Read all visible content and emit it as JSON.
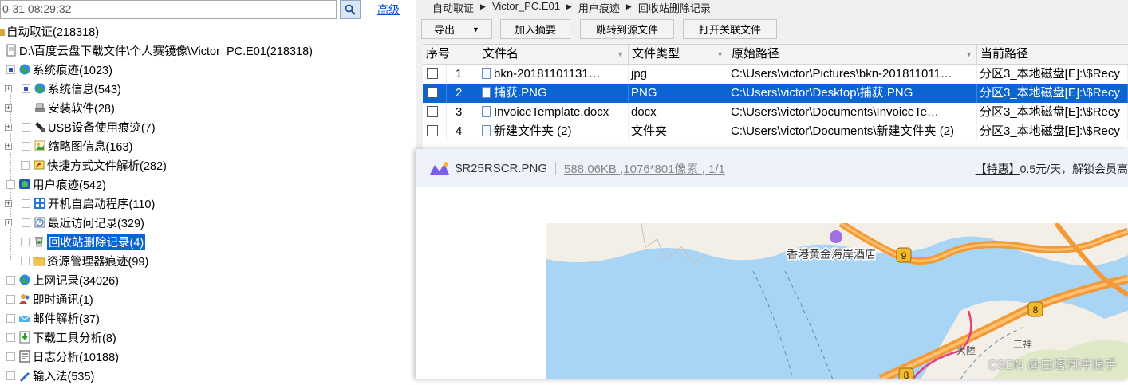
{
  "search": {
    "value": "0-31 08:29:32",
    "advanced_label": "高级"
  },
  "tree": [
    {
      "label": "自动取证(218318)",
      "checked": false
    },
    {
      "label": "D:\\百度云盘下载文件\\个人赛镜像\\Victor_PC.E01(218318)"
    },
    {
      "label": "系统痕迹(1023)"
    },
    {
      "label": "系统信息(543)"
    },
    {
      "label": "安装软件(28)"
    },
    {
      "label": "USB设备使用痕迹(7)"
    },
    {
      "label": "缩略图信息(163)"
    },
    {
      "label": "快捷方式文件解析(282)"
    },
    {
      "label": "用户痕迹(542)"
    },
    {
      "label": "开机自启动程序(110)"
    },
    {
      "label": "最近访问记录(329)"
    },
    {
      "label": "回收站删除记录(4)"
    },
    {
      "label": "资源管理器痕迹(99)"
    },
    {
      "label": "上网记录(34026)"
    },
    {
      "label": "即时通讯(1)"
    },
    {
      "label": "邮件解析(37)"
    },
    {
      "label": "下载工具分析(8)"
    },
    {
      "label": "日志分析(10188)"
    },
    {
      "label": "输入法(535)"
    }
  ],
  "breadcrumb": [
    "自动取证",
    "Victor_PC.E01",
    "用户痕迹",
    "回收站删除记录"
  ],
  "toolbar": {
    "export": "导出",
    "add_summary": "加入摘要",
    "jump_source": "跳转到源文件",
    "open_related": "打开关联文件"
  },
  "table": {
    "headers": [
      "序号",
      "文件名",
      "文件类型",
      "原始路径",
      "当前路径"
    ],
    "rows": [
      {
        "no": "1",
        "name": "bkn-20181101131…",
        "type": "jpg",
        "orig": "C:\\Users\\victor\\Pictures\\bkn-201811011…",
        "cur": "分区3_本地磁盘[E]:\\$Recy"
      },
      {
        "no": "2",
        "name": "捕获.PNG",
        "type": "PNG",
        "orig": "C:\\Users\\victor\\Desktop\\捕获.PNG",
        "cur": "分区3_本地磁盘[E]:\\$Recy"
      },
      {
        "no": "3",
        "name": "InvoiceTemplate.docx",
        "type": "docx",
        "orig": "C:\\Users\\victor\\Documents\\InvoiceTe…",
        "cur": "分区3_本地磁盘[E]:\\$Recy"
      },
      {
        "no": "4",
        "name": "新建文件夹 (2)",
        "type": "文件夹",
        "orig": "C:\\Users\\victor\\Documents\\新建文件夹 (2)",
        "cur": "分区3_本地磁盘[E]:\\$Recy"
      }
    ]
  },
  "viewer": {
    "filename": "$R25RSCR.PNG",
    "meta": "588.06KB ,1076*801像素 , 1/1",
    "promo_tag": "【特惠】",
    "promo_text": "0.5元/天，解锁会员高",
    "map_label_hotel": "香港黄金海岸酒店",
    "map_badge_9": "9",
    "map_badge_8a": "8",
    "map_badge_8b": "8",
    "map_label_sanchi": "三神",
    "map_label_left": "大陸",
    "watermark": "CSDN @白塔河冲浪手"
  },
  "colors": {
    "selection": "#0a64d2",
    "sea": "#a8d4f5",
    "land": "#f3efe6",
    "road": "#f39a36"
  }
}
